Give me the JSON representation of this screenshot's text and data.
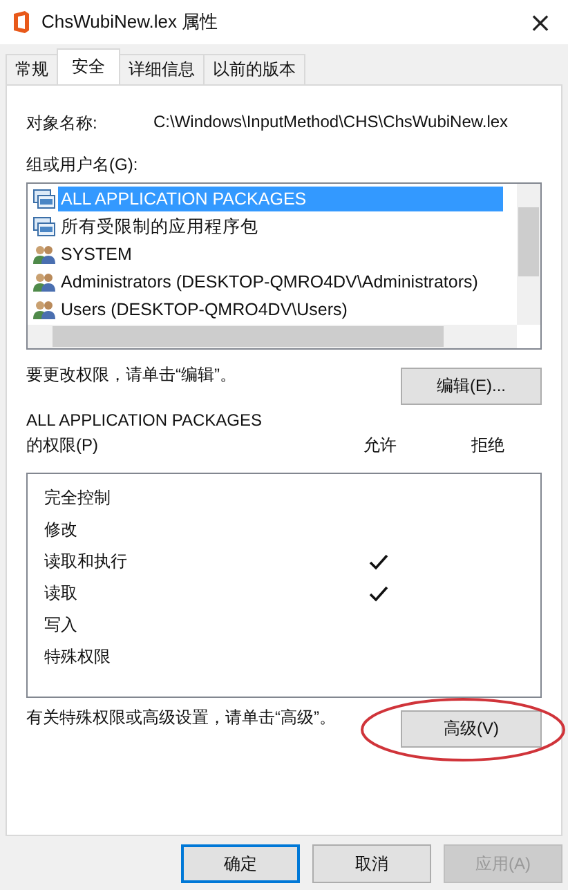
{
  "window": {
    "title": "ChsWubiNew.lex 属性",
    "close": "×"
  },
  "tabs": [
    {
      "label": "常规",
      "selected": false
    },
    {
      "label": "安全",
      "selected": true
    },
    {
      "label": "详细信息",
      "selected": false
    },
    {
      "label": "以前的版本",
      "selected": false
    }
  ],
  "object_name": {
    "label": "对象名称:",
    "value": "C:\\Windows\\InputMethod\\CHS\\ChsWubiNew.lex"
  },
  "groups": {
    "label": "组或用户名(G):",
    "items": [
      {
        "kind": "package",
        "name": "ALL APPLICATION PACKAGES",
        "selected": true
      },
      {
        "kind": "package",
        "name": "所有受限制的应用程序包",
        "selected": false
      },
      {
        "kind": "group",
        "name": "SYSTEM",
        "selected": false
      },
      {
        "kind": "group",
        "name": "Administrators (DESKTOP-QMRO4DV\\Administrators)",
        "selected": false
      },
      {
        "kind": "group",
        "name": "Users (DESKTOP-QMRO4DV\\Users)",
        "selected": false
      }
    ]
  },
  "edit_hint": "要更改权限，请单击“编辑”。",
  "edit_button": "编辑(E)...",
  "permissions": {
    "subject": "ALL APPLICATION PACKAGES",
    "label": "的权限(P)",
    "allow_header": "允许",
    "deny_header": "拒绝",
    "rows": [
      {
        "name": "完全控制",
        "allow": false
      },
      {
        "name": "修改",
        "allow": false
      },
      {
        "name": "读取和执行",
        "allow": true
      },
      {
        "name": "读取",
        "allow": true
      },
      {
        "name": "写入",
        "allow": false
      },
      {
        "name": "特殊权限",
        "allow": false
      }
    ]
  },
  "advanced_hint": "有关特殊权限或高级设置，请单击“高级”。",
  "advanced_button": {
    "label": "高级(V)",
    "highlighted": true
  },
  "buttons": [
    {
      "label": "确定",
      "default": true,
      "disabled": false
    },
    {
      "label": "取消",
      "default": false,
      "disabled": false
    },
    {
      "label": "应用(A)",
      "default": false,
      "disabled": true
    }
  ]
}
